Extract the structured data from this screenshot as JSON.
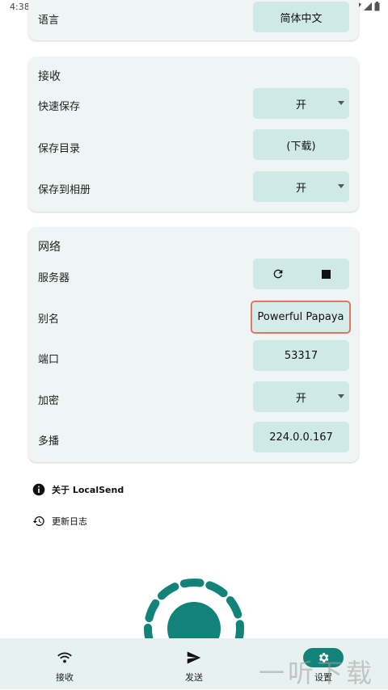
{
  "status_bar": {
    "time": "4:38"
  },
  "settings": {
    "language_label": "语言",
    "language_value": "简体中文"
  },
  "receive": {
    "title": "接收",
    "rows": [
      {
        "label": "快速保存",
        "value": "开"
      },
      {
        "label": "保存目录",
        "value": "(下载)"
      },
      {
        "label": "保存到相册",
        "value": "开"
      }
    ]
  },
  "network": {
    "title": "网络",
    "server_label": "服务器",
    "alias_label": "别名",
    "alias_value": "Powerful Papaya",
    "port_label": "端口",
    "port_value": "53317",
    "encryption_label": "加密",
    "encryption_value": "开",
    "multicast_label": "多播",
    "multicast_value": "224.0.0.167"
  },
  "about": {
    "about_label": "关于 LocalSend",
    "changelog_label": "更新日志"
  },
  "bottom_nav": {
    "receive": "接收",
    "send": "发送",
    "settings": "设置"
  },
  "watermark": "一听下载",
  "colors": {
    "accent": "#138379",
    "card_bg": "#eef5f4",
    "button_bg": "#cfe9e7",
    "highlight_border": "#e37561"
  }
}
